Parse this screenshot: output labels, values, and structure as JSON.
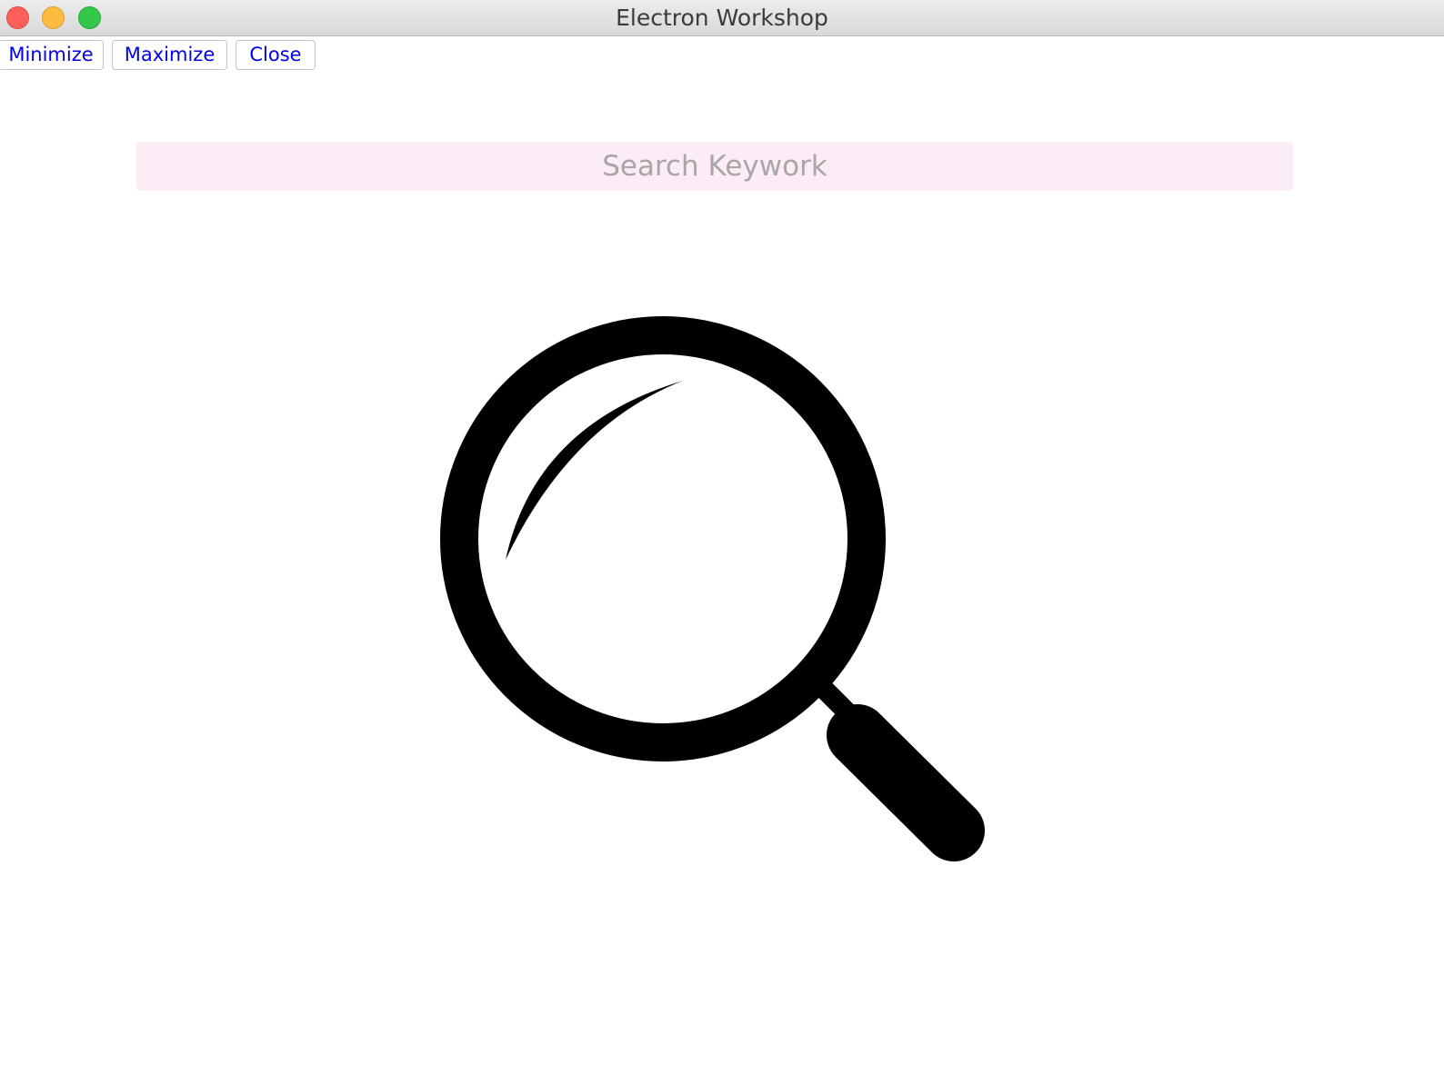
{
  "window": {
    "title": "Electron Workshop"
  },
  "toolbar": {
    "minimize_label": "Minimize",
    "maximize_label": "Maximize",
    "close_label": "Close"
  },
  "search": {
    "placeholder": "Search Keywork",
    "value": ""
  },
  "hero": {
    "icon": "magnifying-glass-icon"
  },
  "colors": {
    "link_text": "#0000ee",
    "search_background": "#fbecf6",
    "placeholder_text": "#a9a6a9",
    "traffic_close": "#fc605b",
    "traffic_minimize": "#fdbc40",
    "traffic_maximize": "#34c84a"
  }
}
